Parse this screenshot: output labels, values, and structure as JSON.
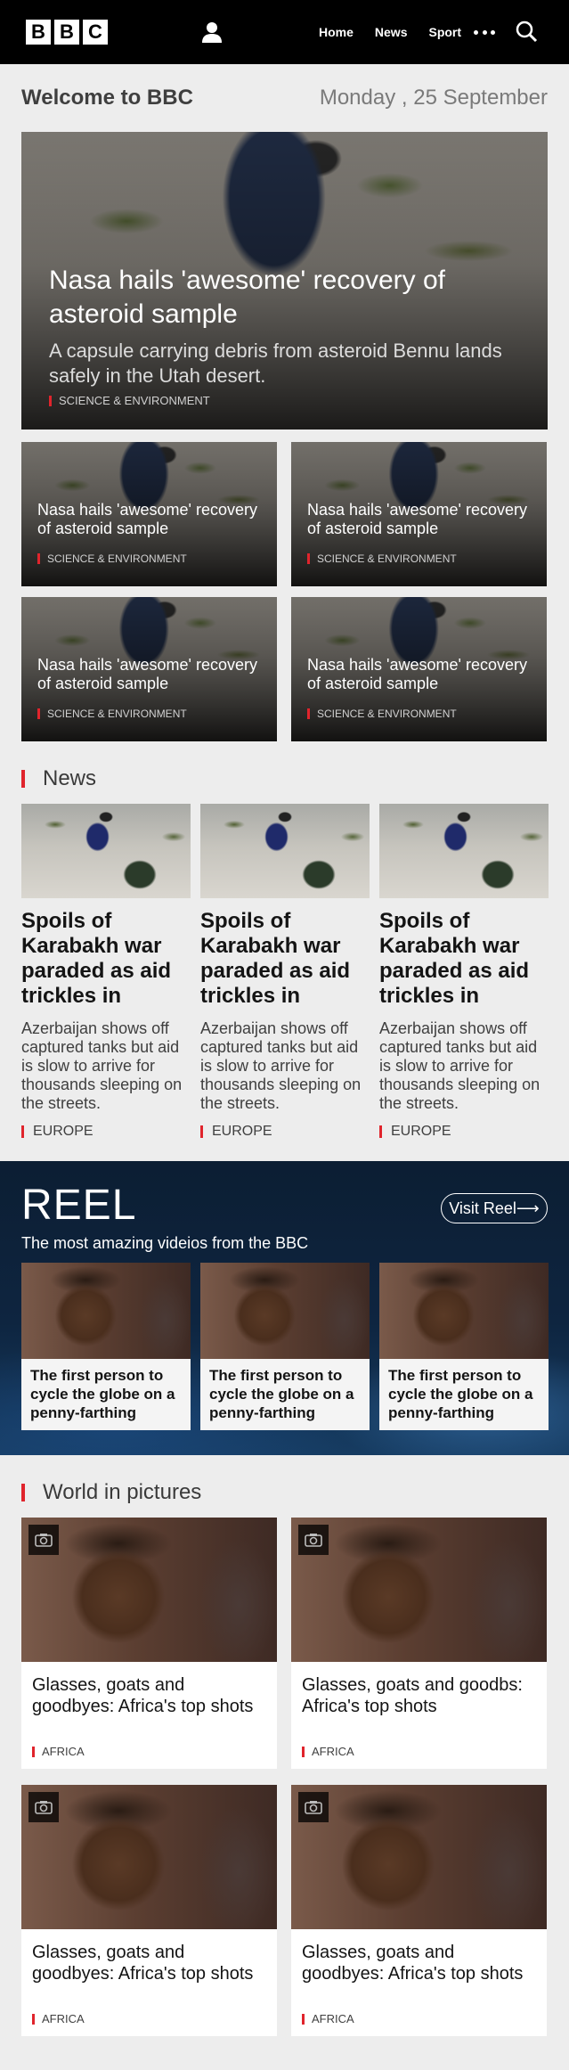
{
  "header": {
    "logo_letters": [
      "B",
      "B",
      "C"
    ],
    "nav": [
      "Home",
      "News",
      "Sport"
    ],
    "icons": {
      "account": "user-icon",
      "more": "more-dots-icon",
      "search": "search-icon"
    }
  },
  "welcome": {
    "title": "Welcome to BBC",
    "date": "Monday , 25 September"
  },
  "hero": {
    "headline": "Nasa hails 'awesome' recovery of asteroid sample",
    "summary": "A capsule carrying debris from asteroid Bennu lands safely in the Utah desert.",
    "tag": "SCIENCE & ENVIRONMENT"
  },
  "small_cards": [
    {
      "headline": "Nasa hails 'awesome' recovery of asteroid sample",
      "tag": "SCIENCE & ENVIRONMENT"
    },
    {
      "headline": "Nasa hails 'awesome' recovery of asteroid sample",
      "tag": "SCIENCE & ENVIRONMENT"
    },
    {
      "headline": "Nasa hails 'awesome' recovery of asteroid sample",
      "tag": "SCIENCE & ENVIRONMENT"
    },
    {
      "headline": "Nasa hails 'awesome' recovery of asteroid sample",
      "tag": "SCIENCE & ENVIRONMENT"
    }
  ],
  "news": {
    "title": "News",
    "items": [
      {
        "headline": "Spoils of Karabakh war paraded as aid trickles in",
        "summary": "Azerbaijan shows off captured tanks but aid is slow to arrive for thousands sleeping on the streets.",
        "tag": "EUROPE"
      },
      {
        "headline": "Spoils of Karabakh war paraded as aid trickles in",
        "summary": "Azerbaijan shows off captured tanks but aid is slow to arrive for thousands sleeping on the streets.",
        "tag": "EUROPE"
      },
      {
        "headline": "Spoils of Karabakh war paraded as aid trickles in",
        "summary": "Azerbaijan shows off captured tanks but aid is slow to arrive for thousands sleeping on the streets.",
        "tag": "EUROPE"
      }
    ]
  },
  "reel": {
    "title": "REEL",
    "subtitle": "The most amazing videios from the BBC",
    "visit_label": "Visit Reel⟶",
    "items": [
      {
        "caption": "The first person to cycle the globe on a penny-farthing"
      },
      {
        "caption": "The first person to cycle the globe on a penny-farthing"
      },
      {
        "caption": "The first person to cycle the globe on a penny-farthing"
      }
    ]
  },
  "world_in_pictures": {
    "title": "World in pictures",
    "items": [
      {
        "headline": "Glasses, goats and goodbyes: Africa's top shots",
        "tag": "AFRICA"
      },
      {
        "headline": "Glasses, goats and goodbs: Africa's top shots",
        "tag": "AFRICA"
      },
      {
        "headline": "Glasses, goats and goodbyes: Africa's top shots",
        "tag": "AFRICA"
      },
      {
        "headline": "Glasses, goats and goodbyes: Africa's top shots",
        "tag": "AFRICA"
      }
    ],
    "icon": "camera-icon"
  },
  "colors": {
    "accent": "#e0242c",
    "header_bg": "#000000",
    "page_bg": "#ededed"
  }
}
